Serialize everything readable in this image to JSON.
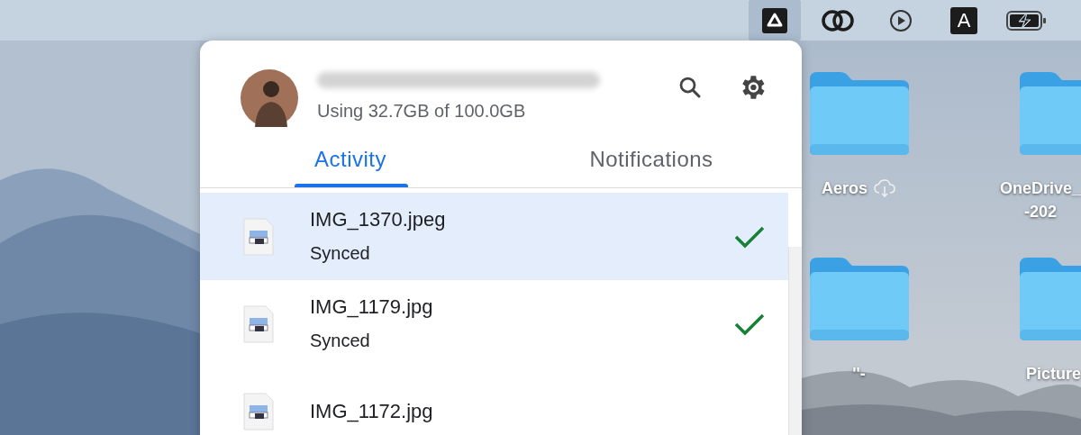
{
  "menu_bar": {
    "items": [
      {
        "kind": "drive",
        "selected": true
      },
      {
        "kind": "rings",
        "selected": false
      },
      {
        "kind": "play",
        "selected": false
      },
      {
        "kind": "letter",
        "text": "A",
        "selected": false
      },
      {
        "kind": "battery",
        "selected": false
      }
    ]
  },
  "popup": {
    "account": {
      "usage": "Using 32.7GB of 100.0GB"
    },
    "tabs": [
      {
        "label": "Activity",
        "selected": true
      },
      {
        "label": "Notifications",
        "selected": false
      }
    ],
    "files": [
      {
        "name": "IMG_1370.jpeg",
        "status": "Synced",
        "selected": true
      },
      {
        "name": "IMG_1179.jpg",
        "status": "Synced",
        "selected": false
      },
      {
        "name": "IMG_1172.jpg",
        "selected": false
      }
    ]
  },
  "desktop": {
    "folders": [
      {
        "lines": [
          "Aeros"
        ],
        "cloud": true
      },
      {
        "lines": [
          "OneDrive_",
          "-202"
        ]
      },
      {
        "lines": [
          "''-"
        ]
      },
      {
        "lines": [
          "Picture"
        ]
      }
    ]
  }
}
